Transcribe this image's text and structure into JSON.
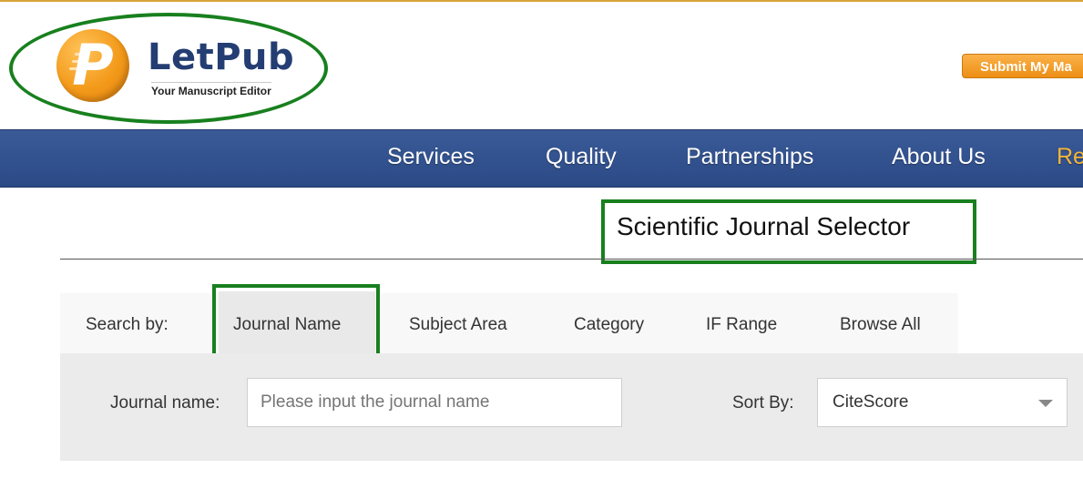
{
  "header": {
    "logo": {
      "name": "LetPub",
      "tagline": "Your Manuscript Editor",
      "letter": "P",
      "icon": "letpub-logo-icon"
    },
    "submit_button_label": "Submit My Ma"
  },
  "nav": {
    "items": [
      {
        "label": "Services"
      },
      {
        "label": "Quality"
      },
      {
        "label": "Partnerships"
      },
      {
        "label": "About Us"
      },
      {
        "label": "Re"
      }
    ]
  },
  "page": {
    "title": "Scientific Journal Selector"
  },
  "search": {
    "search_by_label": "Search by:",
    "tabs": [
      {
        "label": "Journal Name",
        "active": true
      },
      {
        "label": "Subject Area"
      },
      {
        "label": "Category"
      },
      {
        "label": "IF Range"
      },
      {
        "label": "Browse All"
      }
    ],
    "journal_name_label": "Journal name:",
    "journal_name_placeholder": "Please input the journal name",
    "journal_name_value": "",
    "sort_by_label": "Sort By:",
    "sort_by_value": "CiteScore",
    "dropdown_icon": "chevron-down-icon"
  },
  "colors": {
    "nav_background": "#2f4f8f",
    "brand_orange": "#f39a1a",
    "brand_navy": "#243e73",
    "highlight_green": "#18801e",
    "nav_accent": "#f2b63a"
  }
}
